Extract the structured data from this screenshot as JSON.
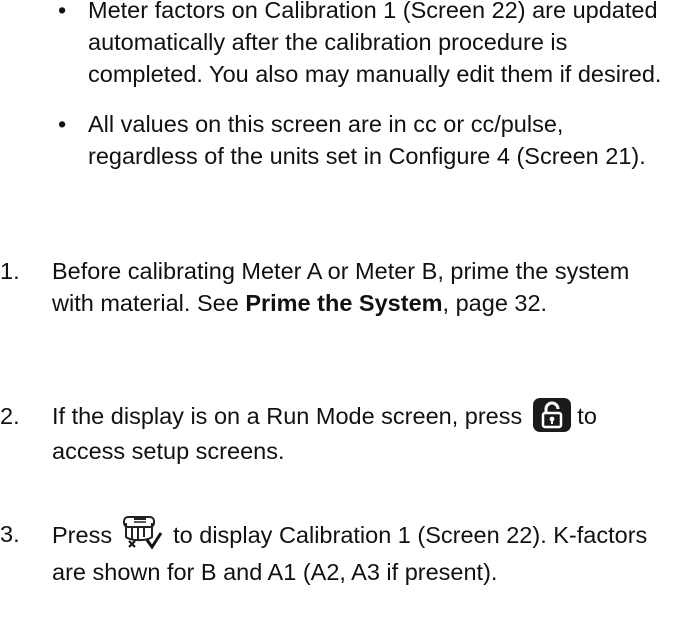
{
  "bullets": [
    {
      "symbol": "•",
      "text": "Meter factors on Calibration 1 (Screen 22) are updated automatically after the calibration procedure is completed. You also may manually edit them if desired."
    },
    {
      "symbol": "•",
      "text": "All values on this screen are in cc or cc/pulse, regardless of the units set in Configure 4 (Screen 21)."
    }
  ],
  "steps": [
    {
      "number": "1.",
      "text_before": "Before calibrating Meter A or Meter B, prime the system with material. See ",
      "bold": "Prime the System",
      "text_after": ", page 32."
    },
    {
      "number": "2.",
      "text_before": "If the display is on a Run Mode screen, press ",
      "icon": "setup-lock-key-icon",
      "text_after": " to access setup screens."
    },
    {
      "number": "3.",
      "text_before": "Press ",
      "icon": "calibration-key-icon",
      "text_after": " to display Calibration 1 (Screen 22). K-factors are shown for B and A1 (A2, A3 if present)."
    }
  ]
}
